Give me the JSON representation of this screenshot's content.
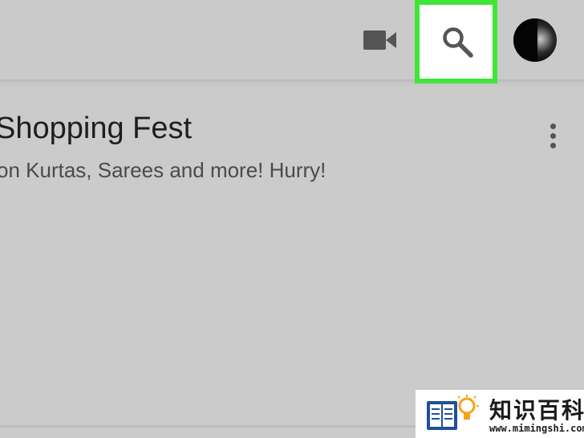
{
  "toolbar": {
    "video_icon": "video-camera-icon",
    "search_icon": "search-icon",
    "avatar_icon": "account-avatar",
    "highlight_color": "#3fe637"
  },
  "notification": {
    "title": "Shopping Fest",
    "body": "on Kurtas, Sarees and more! Hurry!",
    "menu_icon": "more-vertical-icon"
  },
  "watermark": {
    "title": "知识百科",
    "url": "www.mimingshi.com"
  }
}
